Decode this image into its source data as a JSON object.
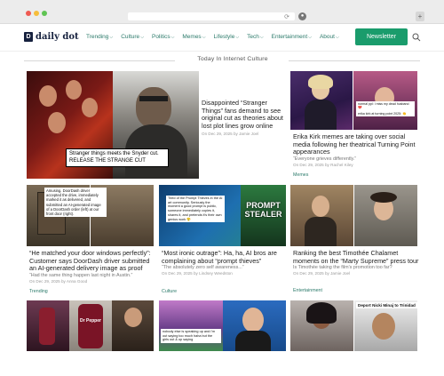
{
  "browser": {
    "reload_glyph": "⟳",
    "extra_glyph": "+"
  },
  "site": {
    "logo_mark": "D",
    "logo_text": "daily dot",
    "menu": [
      {
        "label": "Trending"
      },
      {
        "label": "Culture"
      },
      {
        "label": "Politics"
      },
      {
        "label": "Memes"
      },
      {
        "label": "Lifestyle"
      },
      {
        "label": "Tech"
      },
      {
        "label": "Entertainment"
      },
      {
        "label": "About"
      }
    ],
    "chevron": "⌵",
    "newsletter_label": "Newsletter",
    "accent": "#1a9c6c",
    "link_color": "#2b7a6a"
  },
  "section": {
    "title": "Today In Internet Culture"
  },
  "featured": {
    "caption_line1": "Stranger things meets the Snyder cut.",
    "caption_line2": "RELEASE THE STRANGE CUT",
    "title": "Disappointed “Stranger Things” fans demand to see original cut as theories about lost plot lines grow online",
    "meta": "On Dec 29, 2025 by Jamie Joel"
  },
  "cards": [
    {
      "title": "Erika Kirk memes are taking over social media following her theatrical Turning Point appearances",
      "sub": "“Everyone grieves differently.”",
      "meta": "On Dec 29, 2025 by Rachel Kiley",
      "category": "Memes",
      "overlay_1": "normal ppl: i miss my dead husband 💔",
      "overlay_2": "erika kirk at turning point 2025: 👏"
    },
    {
      "title": "“He matched your door windows perfectly”: Customer says DoorDash driver submitted an AI-generated delivery image as proof",
      "sub": "“Had the same thing happen last night in Austin.”",
      "meta": "On Dec 29, 2025 by Anna Good",
      "category": "Trending",
      "overlay": "Amusing. DoorDash driver accepted the drive, immediately marked it as delivered, and submitted an AI-generated image of a DoorDash order (left) at our front door (right)."
    },
    {
      "title": "“Most ironic outrage”: Ha, ha, AI bros are complaining about “prompt thieves”",
      "sub": "“The absolutely zero self awareness...”",
      "meta": "On Dec 29, 2025 by Lindsey Weedston",
      "category": "Culture",
      "overlay": "Tired of the Prompt Thieves in the AI art community. Seriously the moment a good prompt is public, someone immediately copies it, shares it, and pretends it's their own genius work 😤",
      "banner_line1": "PROMPT",
      "banner_line2": "STEALER"
    },
    {
      "title": "Ranking the best Timothée Chalamet moments on the “Marty Supreme” press tour",
      "sub": "Is Timothée taking the film's promotion too far?",
      "meta": "On Dec 29, 2025 by Jamie Joel",
      "category": "Entertainment"
    }
  ],
  "bottom": {
    "dr_pepper_label": "Dr Pepper",
    "quote_overlay": "nobody else is speaking up and i'm out saying too much haha but the girls out & up saying",
    "headline_strip": "Deport Nicki Minaj to Trinidad"
  }
}
